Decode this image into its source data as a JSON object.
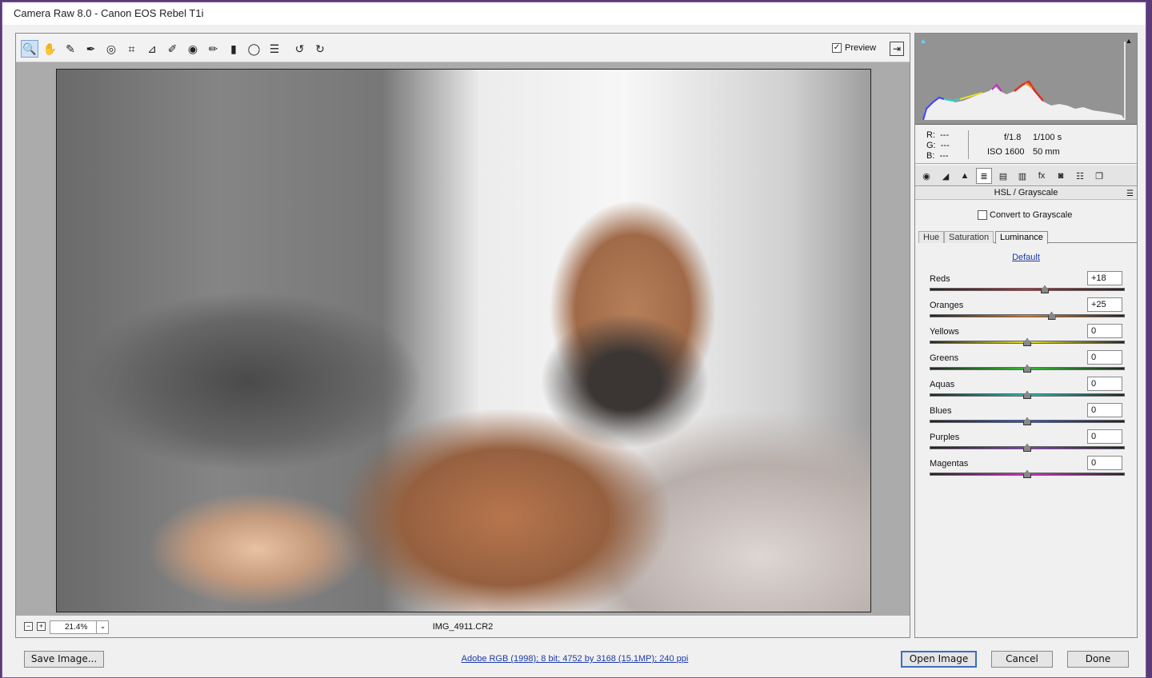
{
  "window": {
    "title": "Camera Raw 8.0  -  Canon EOS Rebel T1i"
  },
  "toolbar": {
    "tools": [
      {
        "name": "zoom-tool",
        "glyph": "🔍"
      },
      {
        "name": "hand-tool",
        "glyph": "✋"
      },
      {
        "name": "white-balance-tool",
        "glyph": "✎"
      },
      {
        "name": "color-sampler-tool",
        "glyph": "✒"
      },
      {
        "name": "targeted-adjustment-tool",
        "glyph": "◎"
      },
      {
        "name": "crop-tool",
        "glyph": "⌗"
      },
      {
        "name": "straighten-tool",
        "glyph": "⊿"
      },
      {
        "name": "spot-removal-tool",
        "glyph": "✐"
      },
      {
        "name": "red-eye-removal-tool",
        "glyph": "◉"
      },
      {
        "name": "adjustment-brush-tool",
        "glyph": "✏"
      },
      {
        "name": "graduated-filter-tool",
        "glyph": "▮"
      },
      {
        "name": "radial-filter-tool",
        "glyph": "◯"
      },
      {
        "name": "preferences-tool",
        "glyph": "☰"
      },
      {
        "name": "rotate-left-tool",
        "glyph": "↺"
      },
      {
        "name": "rotate-right-tool",
        "glyph": "↻"
      }
    ],
    "preview_label": "Preview",
    "preview_checked": true
  },
  "statusbar": {
    "zoom": "21.4%",
    "filename": "IMG_4911.CR2"
  },
  "readout": {
    "r_label": "R:",
    "r_value": "---",
    "g_label": "G:",
    "g_value": "---",
    "b_label": "B:",
    "b_value": "---",
    "aperture": "f/1.8",
    "shutter": "1/100 s",
    "iso": "ISO 1600",
    "focal": "50 mm"
  },
  "panel": {
    "title": "HSL / Grayscale",
    "convert_label": "Convert to Grayscale",
    "tabs": {
      "hue": "Hue",
      "saturation": "Saturation",
      "luminance": "Luminance"
    },
    "default_link": "Default",
    "sliders": [
      {
        "label": "Reds",
        "value": "+18",
        "pos": 18,
        "gradient": [
          "#222",
          "#d02030"
        ]
      },
      {
        "label": "Oranges",
        "value": "+25",
        "pos": 25,
        "gradient": [
          "#222",
          "#e07a20"
        ]
      },
      {
        "label": "Yellows",
        "value": "0",
        "pos": 0,
        "gradient": [
          "#222",
          "#e8e020"
        ]
      },
      {
        "label": "Greens",
        "value": "0",
        "pos": 0,
        "gradient": [
          "#222",
          "#30c030"
        ]
      },
      {
        "label": "Aquas",
        "value": "0",
        "pos": 0,
        "gradient": [
          "#222",
          "#20c0b0"
        ]
      },
      {
        "label": "Blues",
        "value": "0",
        "pos": 0,
        "gradient": [
          "#222",
          "#3050e0"
        ]
      },
      {
        "label": "Purples",
        "value": "0",
        "pos": 0,
        "gradient": [
          "#222",
          "#9030d0"
        ]
      },
      {
        "label": "Magentas",
        "value": "0",
        "pos": 0,
        "gradient": [
          "#222",
          "#d030c0"
        ]
      }
    ]
  },
  "bottom": {
    "save_label": "Save Image...",
    "info_link": "Adobe RGB (1998); 8 bit; 4752 by 3168 (15.1MP); 240 ppi",
    "open_label": "Open Image",
    "cancel_label": "Cancel",
    "done_label": "Done"
  }
}
